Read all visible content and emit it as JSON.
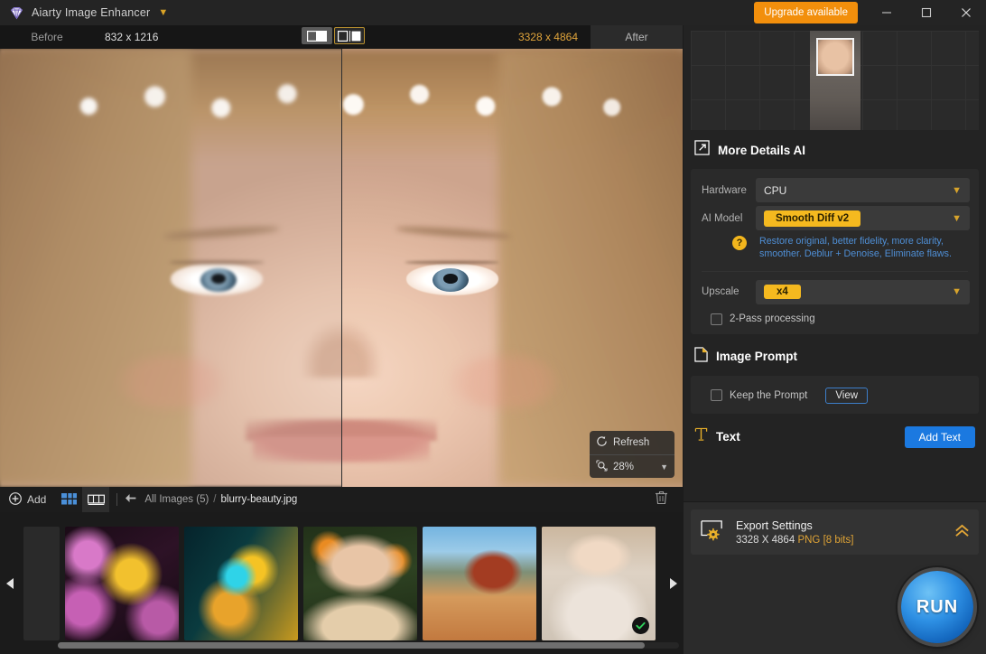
{
  "titlebar": {
    "app_name": "Aiarty Image Enhancer",
    "logo_icon": "diamond-logo-icon",
    "caret_icon": "chevron-down-icon",
    "upgrade_label": "Upgrade available",
    "minimize_icon": "minimize-icon",
    "maximize_icon": "maximize-icon",
    "close_icon": "close-icon",
    "accent": "#f28f0c"
  },
  "compare_bar": {
    "before_label": "Before",
    "before_dimensions": "832 x 1216",
    "after_dimensions": "3328 x 4864",
    "after_label": "After",
    "view_single_icon": "single-view-icon",
    "view_split_icon": "split-view-icon",
    "dim_accent": "#e0a43b"
  },
  "viewer": {
    "refresh_label": "Refresh",
    "refresh_icon": "refresh-icon",
    "zoom_icon": "magnifier-icon",
    "zoom_level": "28%",
    "zoom_caret_icon": "chevron-down-icon"
  },
  "filebar": {
    "add_label": "Add",
    "add_icon": "plus-circle-icon",
    "grid_view_icon": "grid-view-icon",
    "filmstrip_view_icon": "filmstrip-view-icon",
    "back_icon": "arrow-left-icon",
    "breadcrumb_root": "All Images (5)",
    "breadcrumb_sep": "/",
    "breadcrumb_file": "blurry-beauty.jpg",
    "delete_icon": "trash-icon"
  },
  "filmstrip": {
    "prev_icon": "arrow-left-icon",
    "next_icon": "arrow-right-icon",
    "check_icon": "check-circle-icon",
    "selected_index": 4,
    "items": [
      {
        "name": "thumbnail-bird",
        "art": "art-bird"
      },
      {
        "name": "thumbnail-butterfly",
        "art": "art-butterfly"
      },
      {
        "name": "thumbnail-woman-oranges",
        "art": "art-woman"
      },
      {
        "name": "thumbnail-florence-duomo",
        "art": "art-duomo"
      },
      {
        "name": "thumbnail-bride",
        "art": "art-bride"
      }
    ]
  },
  "panel": {
    "navigator_icon": "navigator-preview",
    "more_details": {
      "icon": "expand-arrow-icon",
      "title": "More Details AI",
      "hardware_label": "Hardware",
      "hardware_value": "CPU",
      "ai_model_label": "AI Model",
      "ai_model_value": "Smooth Diff v2",
      "help_icon": "?",
      "model_desc_line1": "Restore original, better fidelity, more clarity,",
      "model_desc_line2": "smoother. Deblur + Denoise, Eliminate flaws.",
      "upscale_label": "Upscale",
      "upscale_value": "x4",
      "two_pass_label": "2-Pass processing",
      "two_pass_checked": false,
      "chevron_icon": "chevron-down-icon",
      "desc_color": "#4f8fd6",
      "pill_color": "#f5b91f"
    },
    "image_prompt": {
      "icon": "document-icon",
      "title": "Image Prompt",
      "keep_prompt_label": "Keep the Prompt",
      "keep_prompt_checked": false,
      "view_label": "View"
    },
    "text_section": {
      "icon": "text-tool-icon",
      "title": "Text",
      "add_text_label": "Add Text",
      "button_color": "#1b79e0"
    },
    "export": {
      "icon": "export-settings-icon",
      "title": "Export Settings",
      "dimensions": "3328 X 4864",
      "format": "PNG",
      "bit_depth": "[8 bits]",
      "collapse_icon": "chevron-up-double-icon",
      "run_label": "RUN"
    }
  }
}
